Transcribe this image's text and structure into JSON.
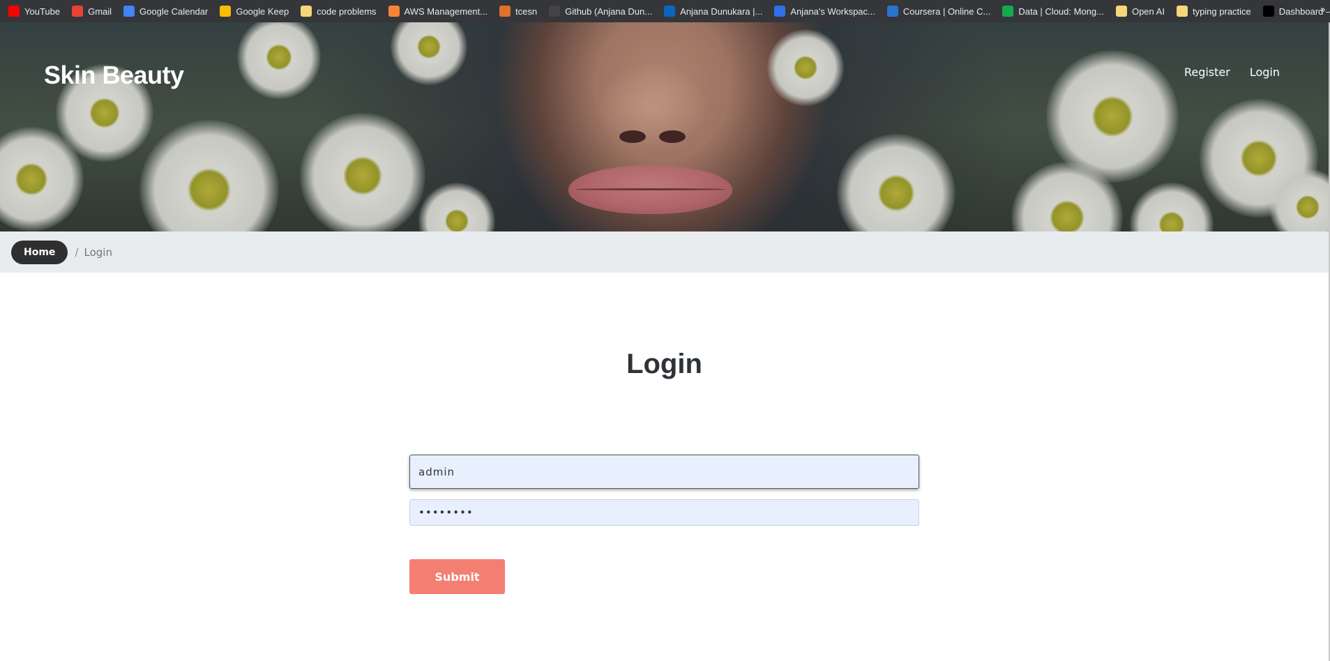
{
  "bookmarks": [
    {
      "label": "YouTube",
      "icon": "youtube-icon",
      "color": "#ff0000"
    },
    {
      "label": "Gmail",
      "icon": "gmail-icon",
      "color": "#ea4335"
    },
    {
      "label": "Google Calendar",
      "icon": "calendar-icon",
      "color": "#4285f4"
    },
    {
      "label": "Google Keep",
      "icon": "keep-icon",
      "color": "#fbbc04"
    },
    {
      "label": "code problems",
      "icon": "folder-icon",
      "color": "#f5d77a"
    },
    {
      "label": "AWS Management...",
      "icon": "aws-icon",
      "color": "#f58534"
    },
    {
      "label": "tcesn",
      "icon": "tcesn-icon",
      "color": "#e0702c"
    },
    {
      "label": "Github (Anjana Dun...",
      "icon": "github-icon",
      "color": "#444444"
    },
    {
      "label": "Anjana Dunukara |...",
      "icon": "linkedin-icon",
      "color": "#0a66c2"
    },
    {
      "label": "Anjana's Workspac...",
      "icon": "workspace-icon",
      "color": "#2f6fe8"
    },
    {
      "label": "Coursera | Online C...",
      "icon": "coursera-icon",
      "color": "#2a73cc"
    },
    {
      "label": "Data | Cloud: Mong...",
      "icon": "mongodb-icon",
      "color": "#13aa52"
    },
    {
      "label": "Open AI",
      "icon": "folder-icon",
      "color": "#f5d77a"
    },
    {
      "label": "typing practice",
      "icon": "folder-icon",
      "color": "#f5d77a"
    },
    {
      "label": "Dashboard – Vercel",
      "icon": "vercel-icon",
      "color": "#000000"
    }
  ],
  "bookmarks_more": "»",
  "header": {
    "brand": "Skin Beauty",
    "nav": [
      "Register",
      "Login"
    ]
  },
  "breadcrumb": {
    "home": "Home",
    "separator": "/",
    "current": "Login"
  },
  "login": {
    "title": "Login",
    "username_value": "admin",
    "password_value": "••••••••",
    "submit_label": "Submit"
  },
  "colors": {
    "submit": "#f37f73",
    "breadcrumb_bg": "#e9ecef",
    "input_bg": "#e8f0fe"
  }
}
